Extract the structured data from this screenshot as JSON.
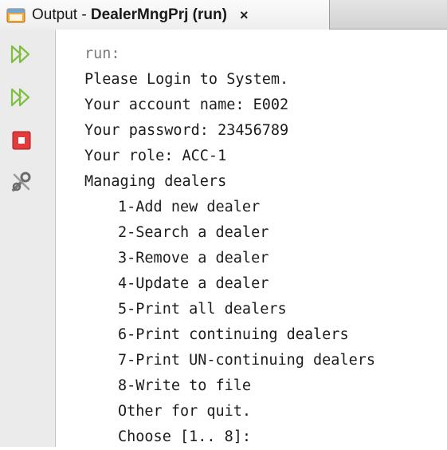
{
  "tab": {
    "title_prefix": "Output - ",
    "title_bold": "DealerMngPrj (run)",
    "close": "×"
  },
  "toolbar": {
    "icons": [
      "rerun-icon",
      "rerun-with-params-icon",
      "stop-icon",
      "settings-icon"
    ]
  },
  "console": {
    "run_line": "run:",
    "header_lines": [
      "Please Login to System.",
      "Your account name: E002",
      "Your password: 23456789",
      "Your role: ACC-1",
      "Managing dealers"
    ],
    "menu_lines": [
      "1-Add new dealer",
      "2-Search a dealer",
      "3-Remove a dealer",
      "4-Update a dealer",
      "5-Print all dealers",
      "6-Print continuing dealers",
      "7-Print UN-continuing dealers",
      "8-Write to file",
      "Other for quit.",
      "Choose [1.. 8]:"
    ]
  },
  "colors": {
    "rerun_green": "#7fbf3f",
    "stop_red": "#e23b3b",
    "gutter_bg": "#ebebeb"
  }
}
